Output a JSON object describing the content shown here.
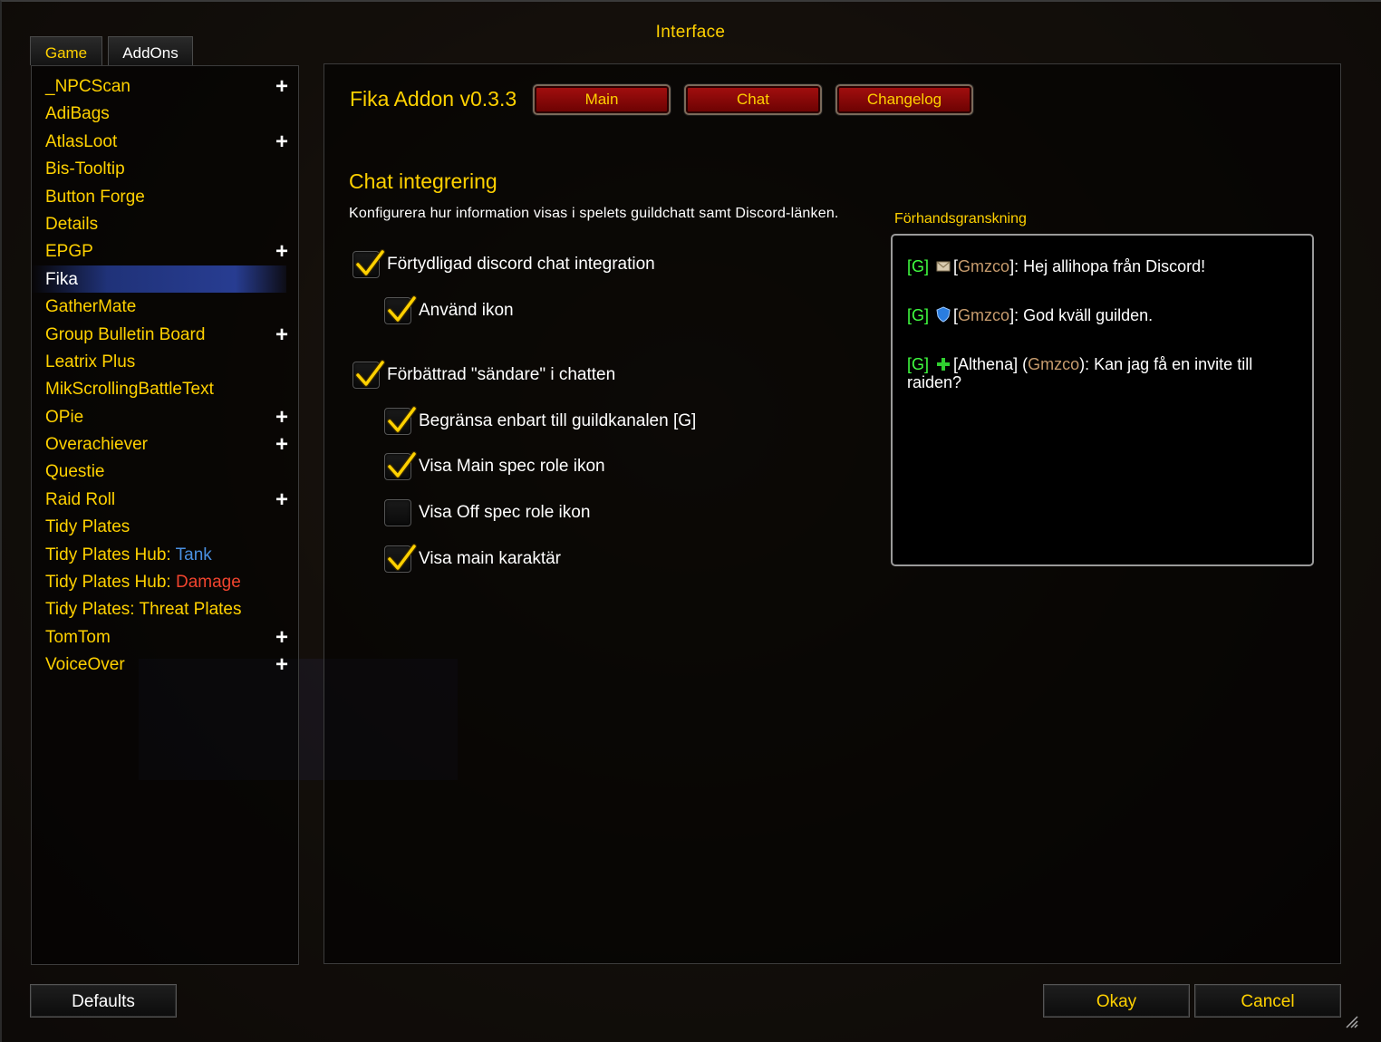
{
  "window": {
    "title": "Interface"
  },
  "tabs": {
    "game": "Game",
    "addons": "AddOns"
  },
  "addons": [
    {
      "label": "_NPCScan",
      "expandable": true
    },
    {
      "label": "AdiBags",
      "expandable": false
    },
    {
      "label": "AtlasLoot",
      "expandable": true
    },
    {
      "label": "Bis-Tooltip",
      "expandable": false
    },
    {
      "label": "Button Forge",
      "expandable": false
    },
    {
      "label": "Details",
      "expandable": false
    },
    {
      "label": "EPGP",
      "expandable": true
    },
    {
      "label": "Fika",
      "expandable": false,
      "selected": true
    },
    {
      "label": "GatherMate",
      "expandable": false
    },
    {
      "label": "Group Bulletin Board",
      "expandable": true
    },
    {
      "label": "Leatrix Plus",
      "expandable": false
    },
    {
      "label": "MikScrollingBattleText",
      "expandable": false
    },
    {
      "label": "OPie",
      "expandable": true
    },
    {
      "label": "Overachiever",
      "expandable": true
    },
    {
      "label": "Questie",
      "expandable": false
    },
    {
      "label": "Raid Roll",
      "expandable": true
    },
    {
      "label": "Tidy Plates",
      "expandable": false
    },
    {
      "label": "Tidy Plates Hub: ",
      "accent": "Tank",
      "accent_color": "#4a90e2",
      "expandable": false
    },
    {
      "label": "Tidy Plates Hub: ",
      "accent": "Damage",
      "accent_color": "#f0442e",
      "expandable": false
    },
    {
      "label": "Tidy Plates: Threat Plates",
      "expandable": false
    },
    {
      "label": "TomTom",
      "expandable": true
    },
    {
      "label": "VoiceOver",
      "expandable": true
    }
  ],
  "addon_panel": {
    "title": "Fika Addon v0.3.3",
    "nav": {
      "main": "Main",
      "chat": "Chat",
      "changelog": "Changelog"
    },
    "section_title": "Chat integrering",
    "section_desc": "Konfigurera hur information visas i spelets guildchatt samt Discord-länken.",
    "options": [
      {
        "label": "Förtydligad discord chat integration",
        "checked": true
      },
      {
        "label": "Använd ikon",
        "checked": true
      },
      {
        "label": "Förbättrad \"sändare\" i chatten",
        "checked": true
      },
      {
        "label": "Begränsa enbart till guildkanalen [G]",
        "checked": true
      },
      {
        "label": "Visa Main spec role ikon",
        "checked": true
      },
      {
        "label": "Visa Off spec role ikon",
        "checked": false
      },
      {
        "label": "Visa main karaktär",
        "checked": true
      }
    ],
    "preview": {
      "label": "Förhandsgranskning",
      "lines": [
        {
          "channel": "[G]",
          "icon": "mail-icon",
          "pre": "[",
          "name": "Gmzco",
          "post": "]: Hej allihopa från Discord!"
        },
        {
          "channel": "[G]",
          "icon": "shield-icon",
          "pre": "[",
          "name": "Gmzco",
          "post": "]: God kväll guilden."
        },
        {
          "channel": "[G]",
          "icon": "healer-cross-icon",
          "pre": "[Althena] (",
          "name": "Gmzco",
          "post": "): Kan jag få en invite till raiden?"
        }
      ]
    }
  },
  "footer": {
    "defaults": "Defaults",
    "okay": "Okay",
    "cancel": "Cancel"
  },
  "colors": {
    "gold": "#ffd100",
    "channel_green": "#40ff40",
    "name_tan": "#c69b6d",
    "button_red": "#a40f0f"
  }
}
